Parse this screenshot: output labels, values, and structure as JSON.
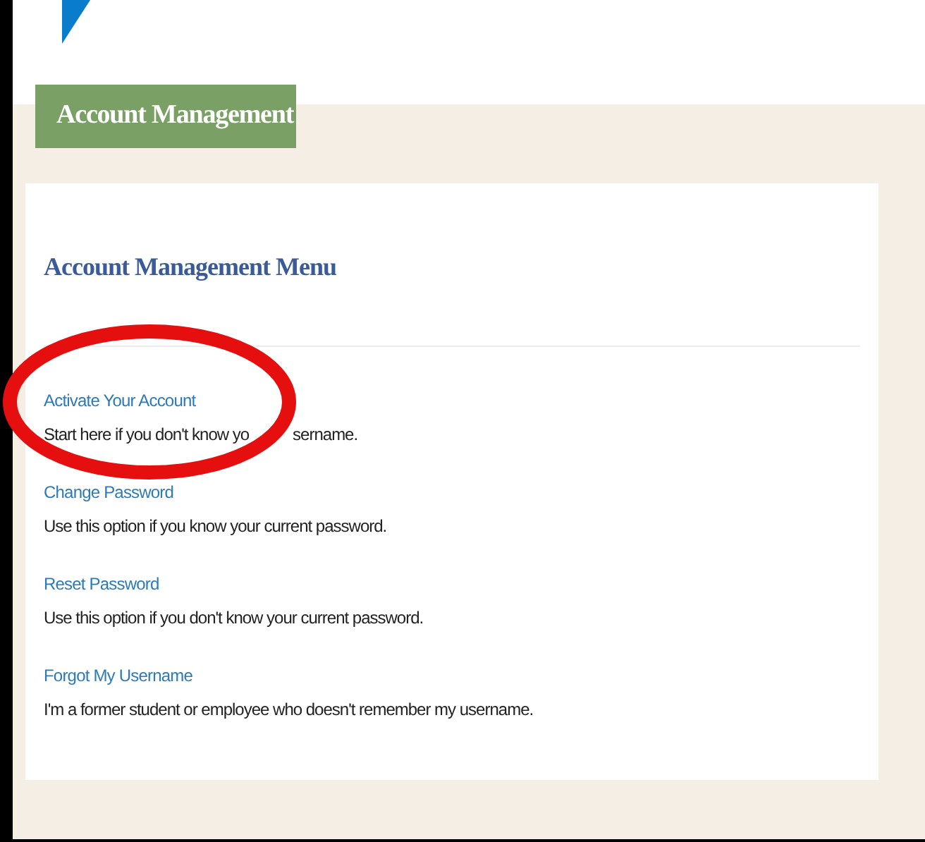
{
  "section_tab": "Account Management",
  "menu": {
    "title": "Account Management Menu",
    "items": [
      {
        "link": "Activate Your Account",
        "description_parts": [
          "Start here if you don't know yo",
          "sername."
        ]
      },
      {
        "link": "Change Password",
        "description": "Use this option if you know your current password."
      },
      {
        "link": "Reset Password",
        "description": "Use this option if you don't know your current password."
      },
      {
        "link": "Forgot My Username",
        "description": "I'm a former student or employee who doesn't remember my username."
      }
    ]
  }
}
